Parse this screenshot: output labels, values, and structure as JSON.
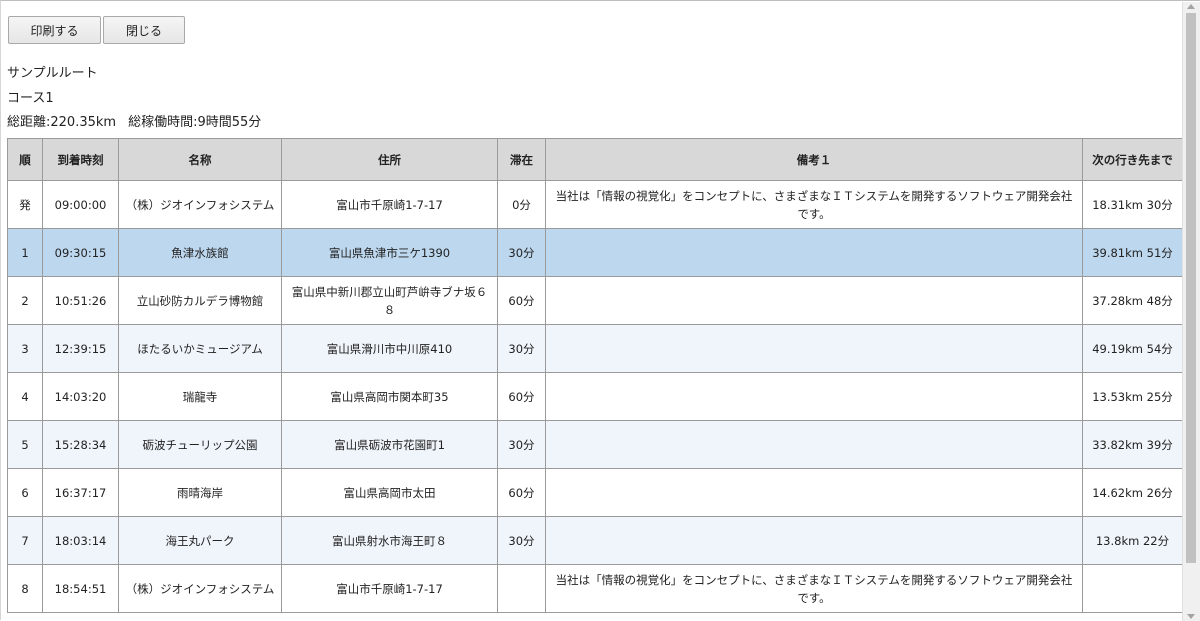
{
  "toolbar": {
    "print_label": "印刷する",
    "close_label": "閉じる"
  },
  "header": {
    "route_name": "サンプルルート",
    "course": "コース1",
    "distance": "総距離:220.35km",
    "work_time": "総稼働時間:9時間55分"
  },
  "table": {
    "columns": [
      "順",
      "到着時刻",
      "名称",
      "住所",
      "滞在",
      "備考１",
      "次の行き先まで"
    ],
    "rows": [
      {
        "order": "発",
        "arrival": "09:00:00",
        "name": "（株）ジオインフォシステム",
        "address": "富山市千原崎1-7-17",
        "stay": "0分",
        "note": "当社は「情報の視覚化」をコンセプトに、さまざまなＩＴシステムを開発するソフトウェア開発会社です。",
        "next": "18.31km 30分"
      },
      {
        "order": "1",
        "arrival": "09:30:15",
        "name": "魚津水族館",
        "address": "富山県魚津市三ケ1390",
        "stay": "30分",
        "note": "",
        "next": "39.81km 51分"
      },
      {
        "order": "2",
        "arrival": "10:51:26",
        "name": "立山砂防カルデラ博物館",
        "address": "富山県中新川郡立山町芦峅寺ブナ坂６８",
        "stay": "60分",
        "note": "",
        "next": "37.28km 48分"
      },
      {
        "order": "3",
        "arrival": "12:39:15",
        "name": "ほたるいかミュージアム",
        "address": "富山県滑川市中川原410",
        "stay": "30分",
        "note": "",
        "next": "49.19km 54分"
      },
      {
        "order": "4",
        "arrival": "14:03:20",
        "name": "瑞龍寺",
        "address": "富山県高岡市関本町35",
        "stay": "60分",
        "note": "",
        "next": "13.53km 25分"
      },
      {
        "order": "5",
        "arrival": "15:28:34",
        "name": "砺波チューリップ公園",
        "address": "富山県砺波市花園町1",
        "stay": "30分",
        "note": "",
        "next": "33.82km 39分"
      },
      {
        "order": "6",
        "arrival": "16:37:17",
        "name": "雨晴海岸",
        "address": "富山県高岡市太田",
        "stay": "60分",
        "note": "",
        "next": "14.62km 26分"
      },
      {
        "order": "7",
        "arrival": "18:03:14",
        "name": "海王丸パーク",
        "address": "富山県射水市海王町８",
        "stay": "30分",
        "note": "",
        "next": "13.8km 22分"
      },
      {
        "order": "8",
        "arrival": "18:54:51",
        "name": "（株）ジオインフォシステム",
        "address": "富山市千原崎1-7-17",
        "stay": "",
        "note": "当社は「情報の視覚化」をコンセプトに、さまざまなＩＴシステムを開発するソフトウェア開発会社です。",
        "next": ""
      }
    ]
  }
}
